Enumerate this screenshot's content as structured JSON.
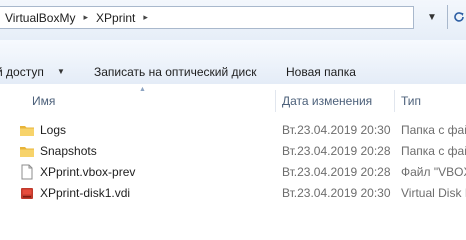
{
  "address": {
    "crumbs": [
      "VirtualBoxMy",
      "XPprint"
    ],
    "separator": "▸",
    "dropdown_icon": "chevron-down-icon",
    "refresh_icon": "refresh-icon"
  },
  "toolbar": {
    "share_label": "й доступ",
    "burn_label": "Записать на оптический диск",
    "new_folder_label": "Новая папка"
  },
  "columns": {
    "name": "Имя",
    "date": "Дата изменения",
    "type": "Тип"
  },
  "files": [
    {
      "name": "Logs",
      "date": "Вт.23.04.2019 20:30",
      "type": "Папка с фай",
      "icon": "folder-icon"
    },
    {
      "name": "Snapshots",
      "date": "Вт.23.04.2019 20:28",
      "type": "Папка с фай",
      "icon": "folder-icon"
    },
    {
      "name": "XPprint.vbox-prev",
      "date": "Вт.23.04.2019 20:28",
      "type": "Файл \"VBOX",
      "icon": "file-icon"
    },
    {
      "name": "XPprint-disk1.vdi",
      "date": "Вт.23.04.2019 20:30",
      "type": "Virtual Disk I",
      "icon": "virtual-disk-icon"
    }
  ]
}
